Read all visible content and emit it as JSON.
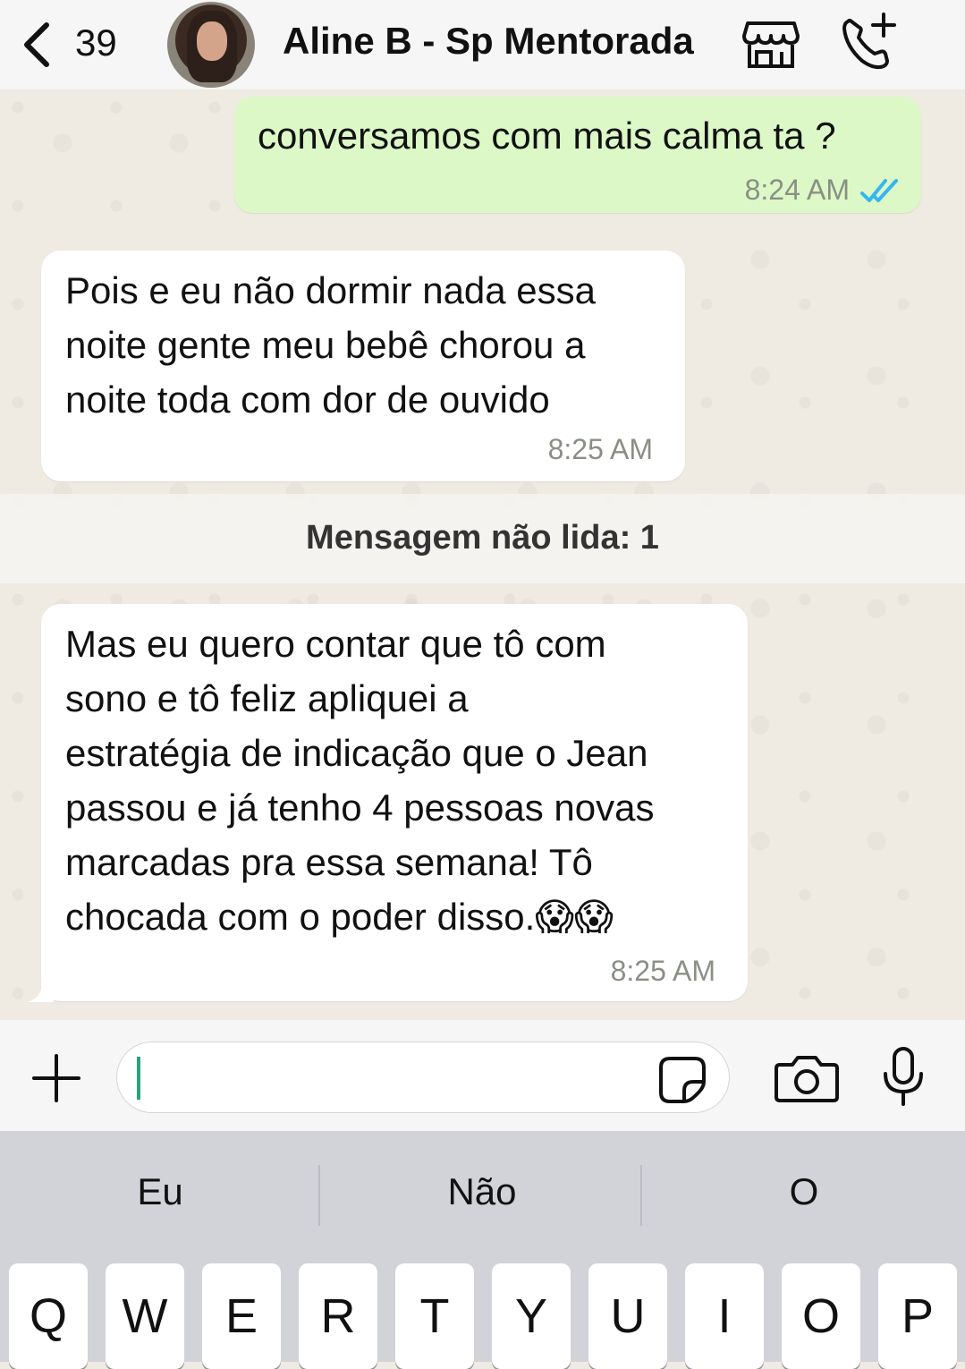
{
  "header": {
    "back_count": "39",
    "contact_name": "Aline B - Sp Mentorada"
  },
  "messages": [
    {
      "direction": "outgoing",
      "text": "conversamos com mais calma ta ?",
      "time": "8:24 AM",
      "status": "read"
    },
    {
      "direction": "incoming",
      "text": "Pois e eu não dormir nada essa\nnoite gente meu bebê chorou a\nnoite toda com dor de ouvido",
      "time": "8:25 AM"
    },
    {
      "direction": "incoming",
      "text": "Mas eu quero contar que tô com\nsono e tô feliz  apliquei a\nestratégia de indicação que o Jean\npassou e já tenho 4 pessoas novas\nmarcadas pra essa semana! Tô\nchocada com o poder disso.😱😱",
      "time": "8:25 AM"
    }
  ],
  "unread_divider": "Mensagem não lida: 1",
  "input": {
    "value": "",
    "placeholder": ""
  },
  "keyboard": {
    "suggestions": [
      "Eu",
      "Não",
      "O"
    ],
    "row1": [
      "Q",
      "W",
      "E",
      "R",
      "T",
      "Y",
      "U",
      "I",
      "O",
      "P"
    ]
  },
  "colors": {
    "outgoing_bubble": "#dcf8c6",
    "incoming_bubble": "#ffffff",
    "read_ticks": "#34b7f1",
    "chat_background": "#efeae2"
  }
}
